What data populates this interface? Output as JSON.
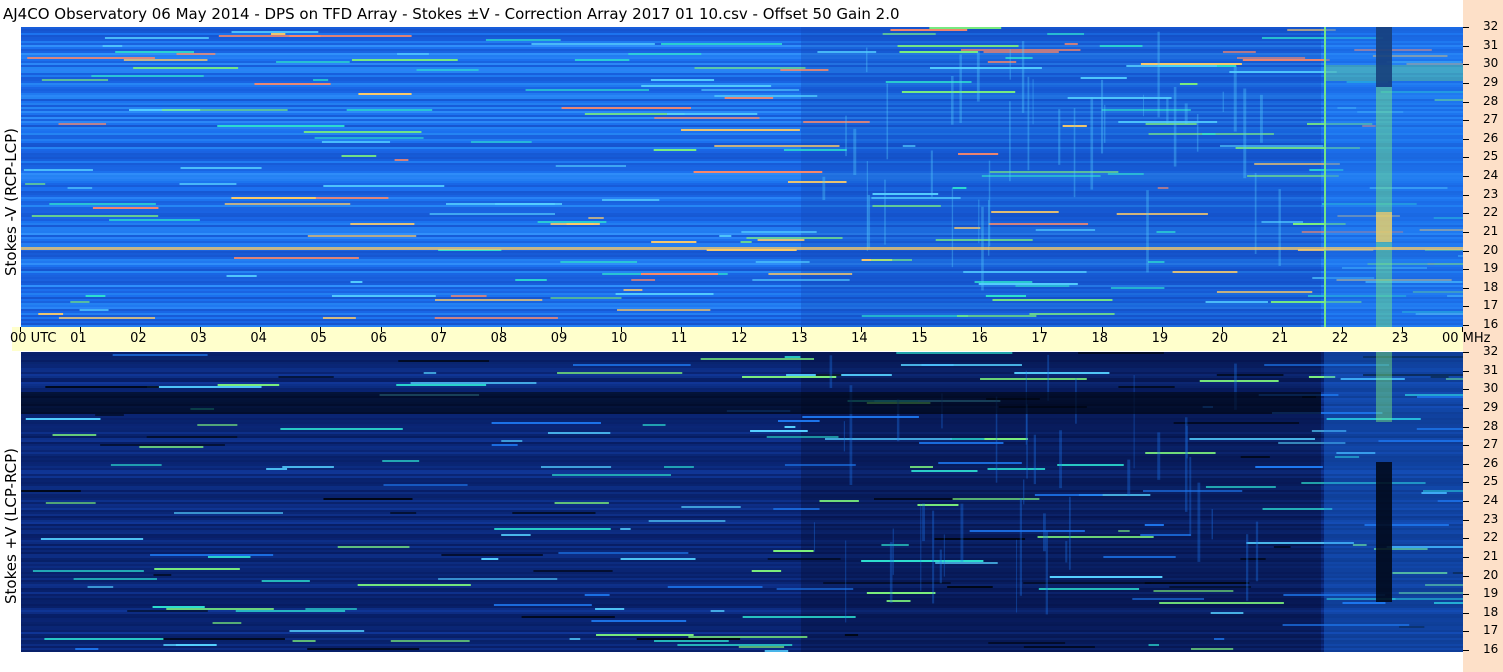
{
  "header": {
    "title": "AJ4CO Observatory  06 May 2014  -  DPS on TFD Array  -  Stokes ±V  -  Correction Array 2017 01 10.csv  -  Offset 50  Gain 2.0"
  },
  "panels": {
    "top_label": "Stokes -V (RCP-LCP)",
    "bottom_label": "Stokes +V (LCP-RCP)"
  },
  "time_axis": {
    "ticks": [
      "00  UTC",
      "01",
      "02",
      "03",
      "04",
      "05",
      "06",
      "07",
      "08",
      "09",
      "10",
      "11",
      "12",
      "13",
      "14",
      "15",
      "16",
      "17",
      "18",
      "19",
      "20",
      "21",
      "22",
      "23",
      "00 MHz"
    ]
  },
  "freq_axis": {
    "ticks": [
      "32",
      "31",
      "30",
      "29",
      "28",
      "27",
      "26",
      "25",
      "24",
      "23",
      "22",
      "21",
      "20",
      "19",
      "18",
      "17",
      "16"
    ]
  },
  "colors": {
    "top_base": "#1a6aee",
    "bottom_base": "#0b2a7a",
    "highlight": "#7cf07c",
    "hot": "#ffcc66",
    "axis_band": "#ffffcc",
    "side_strip": "#fde0c8"
  },
  "chart_data": {
    "type": "heatmap",
    "title": "AJ4CO Observatory  06 May 2014  -  DPS on TFD Array  -  Stokes ±V  -  Correction Array 2017 01 10.csv  -  Offset 50  Gain 2.0",
    "xlabel": "UTC",
    "ylabel": "MHz",
    "xlim": [
      0,
      24
    ],
    "ylim": [
      16,
      32
    ],
    "panels": [
      {
        "name": "Stokes -V (RCP-LCP)"
      },
      {
        "name": "Stokes +V (LCP-RCP)"
      }
    ]
  }
}
